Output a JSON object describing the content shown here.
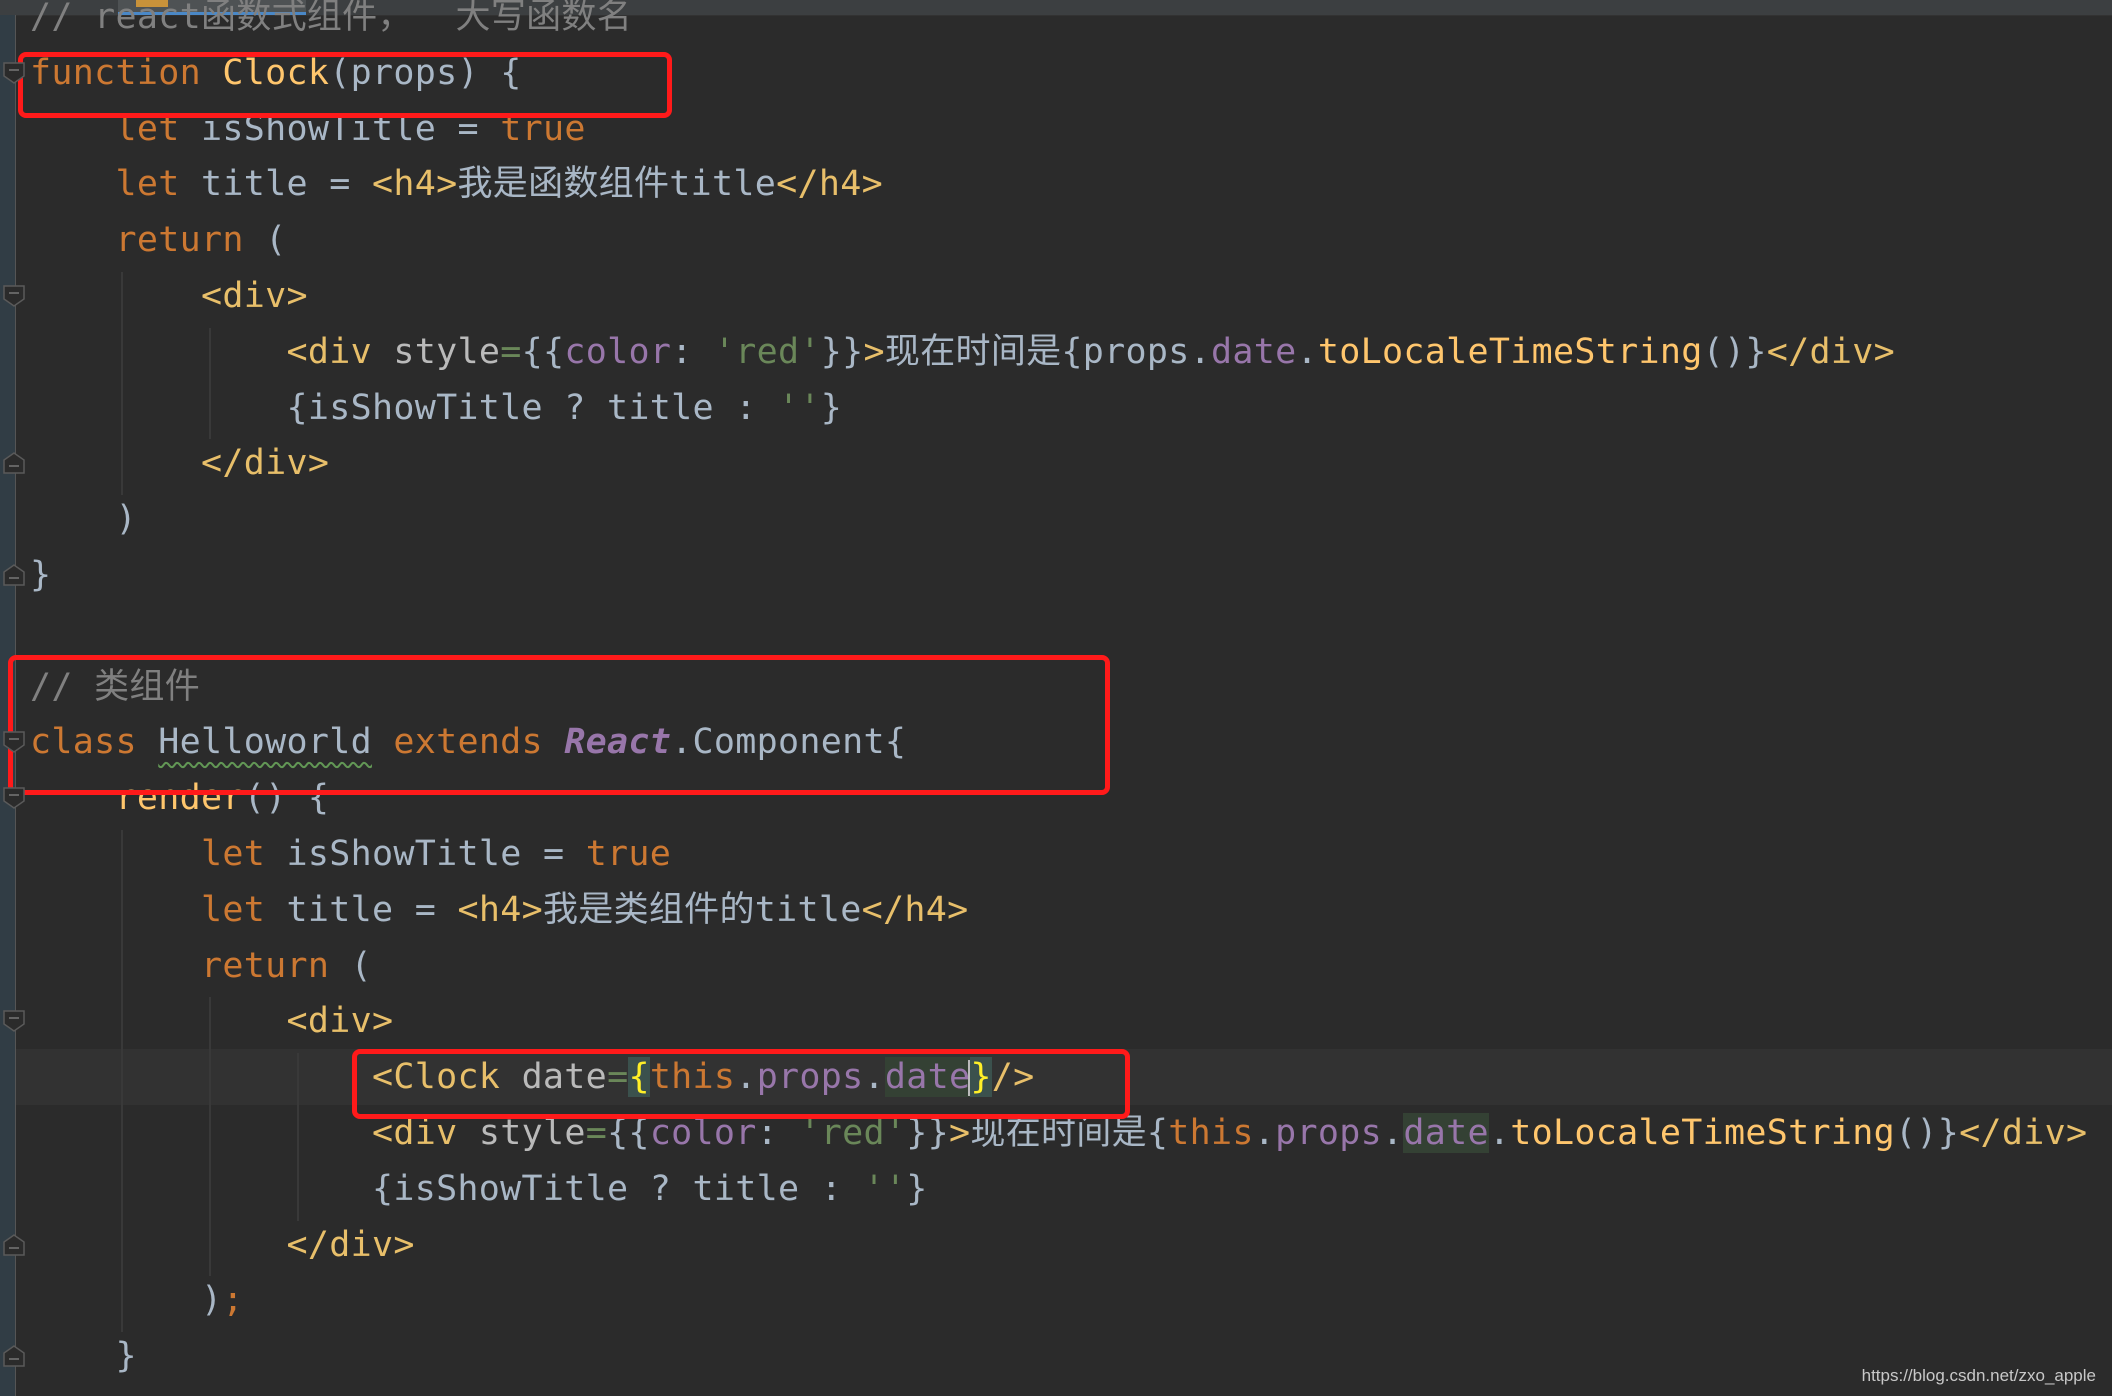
{
  "editor": {
    "language": "javascript",
    "tab": {
      "icon": "js-file-icon"
    },
    "lines": [
      {
        "segments": [
          {
            "t": "// react函数式组件，  大写函数名",
            "c": "cmt"
          }
        ]
      },
      {
        "segments": [
          {
            "t": "function",
            "c": "kw"
          },
          {
            "t": " "
          },
          {
            "t": "Clock",
            "c": "fn"
          },
          {
            "t": "(props) {"
          }
        ]
      },
      {
        "segments": [
          {
            "t": "    "
          },
          {
            "t": "let",
            "c": "kw"
          },
          {
            "t": " isShowTitle = "
          },
          {
            "t": "true",
            "c": "kw"
          }
        ]
      },
      {
        "segments": [
          {
            "t": "    "
          },
          {
            "t": "let",
            "c": "kw"
          },
          {
            "t": " title = "
          },
          {
            "t": "<h4>",
            "c": "tag"
          },
          {
            "t": "我是函数组件title"
          },
          {
            "t": "</h4>",
            "c": "tag"
          }
        ]
      },
      {
        "segments": [
          {
            "t": "    "
          },
          {
            "t": "return",
            "c": "kw"
          },
          {
            "t": " ("
          }
        ]
      },
      {
        "segments": [
          {
            "t": "        "
          },
          {
            "t": "<div>",
            "c": "tag"
          }
        ]
      },
      {
        "segments": [
          {
            "t": "            "
          },
          {
            "t": "<div",
            "c": "tag"
          },
          {
            "t": " "
          },
          {
            "t": "style",
            "c": "attr"
          },
          {
            "t": "=",
            "c": "eq"
          },
          {
            "t": "{{"
          },
          {
            "t": "color",
            "c": "prop"
          },
          {
            "t": ": "
          },
          {
            "t": "'red'",
            "c": "str"
          },
          {
            "t": "}}"
          },
          {
            "t": ">",
            "c": "tag"
          },
          {
            "t": "现在时间是{props."
          },
          {
            "t": "date",
            "c": "prop"
          },
          {
            "t": "."
          },
          {
            "t": "toLocaleTimeString",
            "c": "fn"
          },
          {
            "t": "()}"
          },
          {
            "t": "</div>",
            "c": "tag"
          }
        ]
      },
      {
        "segments": [
          {
            "t": "            {isShowTitle ? title : "
          },
          {
            "t": "''",
            "c": "str"
          },
          {
            "t": "}"
          }
        ]
      },
      {
        "segments": [
          {
            "t": "        "
          },
          {
            "t": "</div>",
            "c": "tag"
          }
        ]
      },
      {
        "segments": [
          {
            "t": "    )"
          }
        ]
      },
      {
        "segments": [
          {
            "t": "}"
          }
        ]
      },
      {
        "segments": [
          {
            "t": ""
          }
        ]
      },
      {
        "segments": [
          {
            "t": "// 类组件",
            "c": "cmt"
          }
        ]
      },
      {
        "segments": [
          {
            "t": "class",
            "c": "kw"
          },
          {
            "t": " "
          },
          {
            "t": "Helloworld",
            "c": "cls squig"
          },
          {
            "t": " "
          },
          {
            "t": "extends",
            "c": "kw"
          },
          {
            "t": " "
          },
          {
            "t": "React",
            "c": "react"
          },
          {
            "t": ".Component{"
          }
        ]
      },
      {
        "segments": [
          {
            "t": "    "
          },
          {
            "t": "render",
            "c": "fn"
          },
          {
            "t": "() {"
          }
        ]
      },
      {
        "segments": [
          {
            "t": "        "
          },
          {
            "t": "let",
            "c": "kw"
          },
          {
            "t": " isShowTitle = "
          },
          {
            "t": "true",
            "c": "kw"
          }
        ]
      },
      {
        "segments": [
          {
            "t": "        "
          },
          {
            "t": "let",
            "c": "kw"
          },
          {
            "t": " title = "
          },
          {
            "t": "<h4>",
            "c": "tag"
          },
          {
            "t": "我是类组件的title"
          },
          {
            "t": "</h4>",
            "c": "tag"
          }
        ]
      },
      {
        "segments": [
          {
            "t": "        "
          },
          {
            "t": "return",
            "c": "kw"
          },
          {
            "t": " ("
          }
        ]
      },
      {
        "segments": [
          {
            "t": "            "
          },
          {
            "t": "<div>",
            "c": "tag"
          }
        ]
      },
      {
        "caret": true,
        "segments": [
          {
            "t": "                "
          },
          {
            "t": "<Clock",
            "c": "tag"
          },
          {
            "t": " "
          },
          {
            "t": "date",
            "c": "attr"
          },
          {
            "t": "=",
            "c": "eq"
          },
          {
            "t": "{",
            "c": "match"
          },
          {
            "t": "this",
            "c": "kw"
          },
          {
            "t": "."
          },
          {
            "t": "props",
            "c": "prop"
          },
          {
            "t": "."
          },
          {
            "t": "date",
            "c": "prop hl"
          },
          {
            "t": "",
            "c": "caret"
          },
          {
            "t": "}",
            "c": "match"
          },
          {
            "t": "/>",
            "c": "tag"
          }
        ]
      },
      {
        "segments": [
          {
            "t": "                "
          },
          {
            "t": "<div",
            "c": "tag"
          },
          {
            "t": " "
          },
          {
            "t": "style",
            "c": "attr"
          },
          {
            "t": "=",
            "c": "eq"
          },
          {
            "t": "{{"
          },
          {
            "t": "color",
            "c": "prop"
          },
          {
            "t": ": "
          },
          {
            "t": "'red'",
            "c": "str"
          },
          {
            "t": "}}"
          },
          {
            "t": ">",
            "c": "tag"
          },
          {
            "t": "现在时间是{"
          },
          {
            "t": "this",
            "c": "kw"
          },
          {
            "t": "."
          },
          {
            "t": "props",
            "c": "prop"
          },
          {
            "t": "."
          },
          {
            "t": "date",
            "c": "prop hl"
          },
          {
            "t": "."
          },
          {
            "t": "toLocaleTimeString",
            "c": "fn"
          },
          {
            "t": "()}"
          },
          {
            "t": "</div>",
            "c": "tag"
          }
        ]
      },
      {
        "segments": [
          {
            "t": "                {isShowTitle ? title : "
          },
          {
            "t": "''",
            "c": "str"
          },
          {
            "t": "}"
          }
        ]
      },
      {
        "segments": [
          {
            "t": "            "
          },
          {
            "t": "</div>",
            "c": "tag"
          }
        ]
      },
      {
        "segments": [
          {
            "t": "        )"
          },
          {
            "t": ";",
            "c": "kw"
          }
        ]
      },
      {
        "segments": [
          {
            "t": "    }"
          }
        ]
      }
    ],
    "annotations": [
      {
        "name": "highlight-function-clock",
        "label": "function Clock(props)"
      },
      {
        "name": "highlight-class-component",
        "label": "class Helloworld extends React.Component"
      },
      {
        "name": "highlight-clock-usage",
        "label": "<Clock date={this.props.date}/>"
      }
    ]
  },
  "watermark": "https://blog.csdn.net/zxo_apple"
}
